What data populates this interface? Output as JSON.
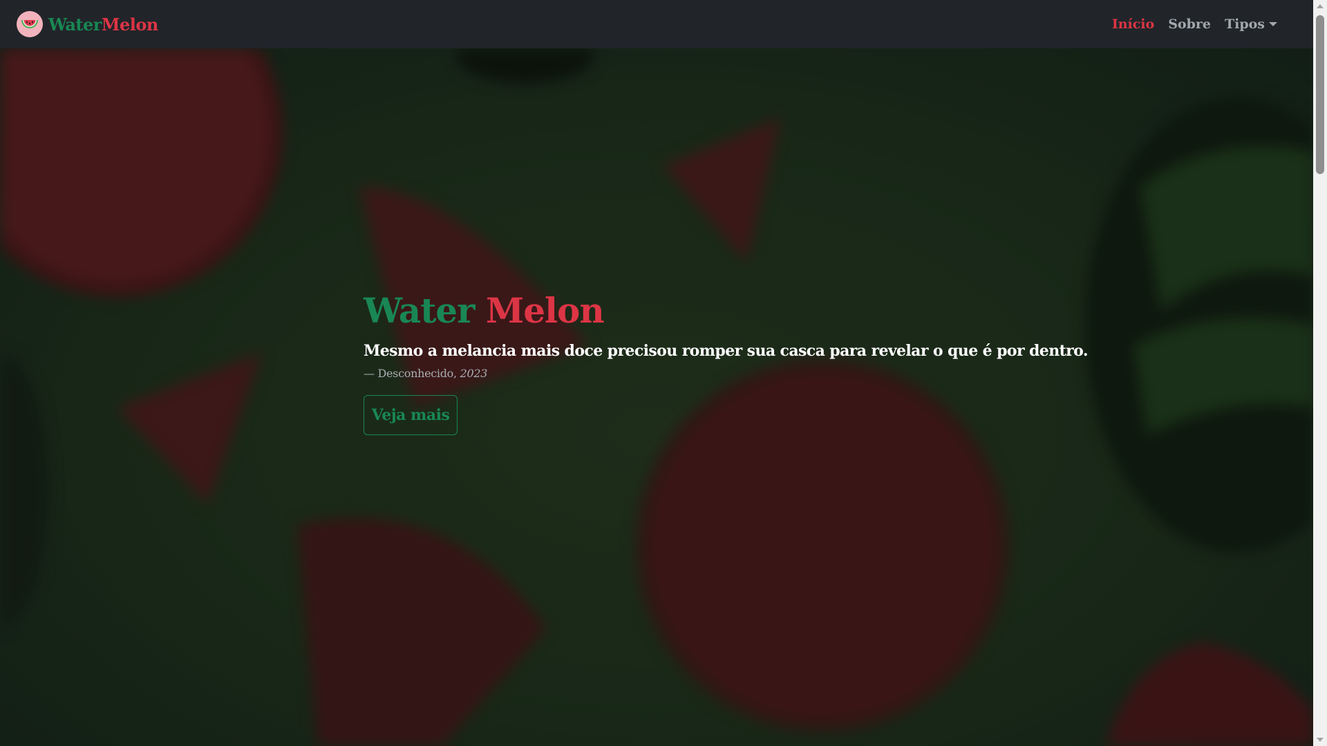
{
  "brand": {
    "logo_icon": "watermelon-slice-icon",
    "name_part1": "Water",
    "name_part2": "Melon"
  },
  "nav": {
    "items": [
      {
        "label": "Início",
        "active": true
      },
      {
        "label": "Sobre",
        "active": false
      },
      {
        "label": "Tipos",
        "active": false,
        "dropdown": true
      }
    ]
  },
  "hero": {
    "title_part1": "Water",
    "title_part2": "Melon",
    "quote": "Mesmo a melancia mais doce precisou romper sua casca para revelar o que é por dentro.",
    "cite_prefix": "— Desconhecido, ",
    "cite_year": "2023",
    "button_label": "Veja mais"
  },
  "colors": {
    "green": "#198754",
    "red": "#dc3545",
    "navbar_bg": "#212529",
    "nav_text": "#a3a8ad"
  }
}
